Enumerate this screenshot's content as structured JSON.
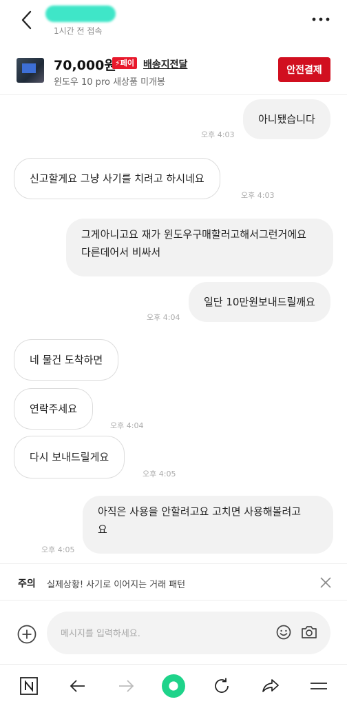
{
  "header": {
    "last_seen": "1시간 전 접속"
  },
  "product": {
    "price": "70,000원",
    "pay_badge": "⚡페이",
    "delivery": "배송지전달",
    "title": "윈도우 10 pro 새상품 미개봉",
    "safe_pay_label": "안전결제"
  },
  "messages": [
    {
      "side": "mine",
      "text": "아니됐습니다",
      "time": "오후 4:03"
    },
    {
      "side": "theirs",
      "text": "신고할게요 그냥 사기를 치려고 하시네요",
      "time": "오후 4:03"
    },
    {
      "side": "mine",
      "line1": "그게아니고요 재가 윈도우구매할러고해서그런거에요",
      "line2": "다른데어서 비싸서"
    },
    {
      "side": "mine",
      "text": "일단 10만원보내드릴깨요",
      "time": "오후 4:04"
    },
    {
      "side": "theirs",
      "text": "네 물건 도착하면"
    },
    {
      "side": "theirs",
      "text": "연락주세요",
      "time": "오후 4:04"
    },
    {
      "side": "theirs",
      "text": "다시 보내드릴게요",
      "time": "오후 4:05"
    },
    {
      "side": "mine",
      "line1": "아직은 사용을 안할려고요 고치면 사용해볼려고",
      "line2": "요",
      "time": "오후 4:05"
    }
  ],
  "warning": {
    "label": "주의",
    "text": "실제상황! 사기로 이어지는 거래 패턴"
  },
  "input": {
    "placeholder": "메시지를 입력하세요."
  },
  "colors": {
    "accent_red": "#d10f1f",
    "pay_red": "#e8192c",
    "name_highlight": "#3fe6c8",
    "home_green": "#1ed38a"
  }
}
